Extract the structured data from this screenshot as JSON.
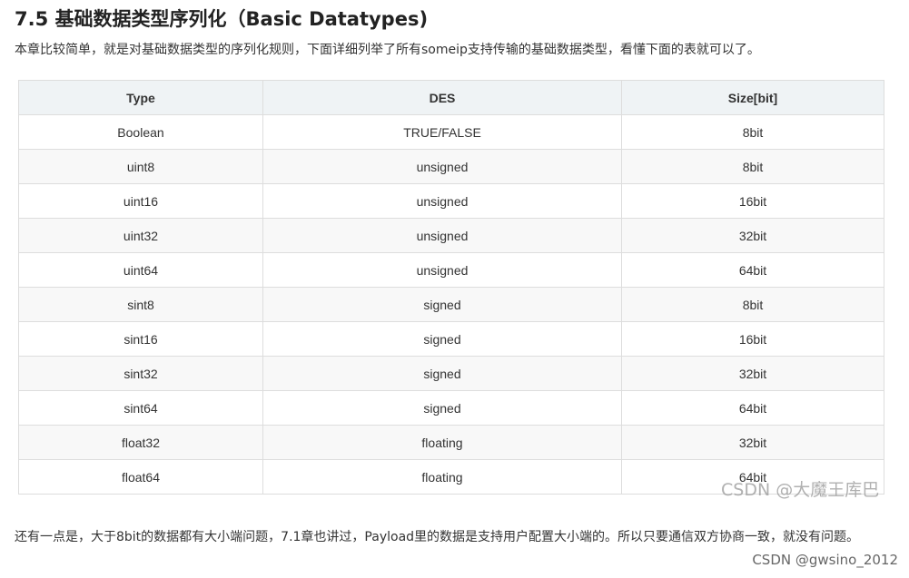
{
  "heading": "7.5 基础数据类型序列化（Basic Datatypes)",
  "intro": "本章比较简单，就是对基础数据类型的序列化规则，下面详细列举了所有someip支持传输的基础数据类型，看懂下面的表就可以了。",
  "table": {
    "headers": [
      "Type",
      "DES",
      "Size[bit]"
    ],
    "rows": [
      [
        "Boolean",
        "TRUE/FALSE",
        "8bit"
      ],
      [
        "uint8",
        "unsigned",
        "8bit"
      ],
      [
        "uint16",
        "unsigned",
        "16bit"
      ],
      [
        "uint32",
        "unsigned",
        "32bit"
      ],
      [
        "uint64",
        "unsigned",
        "64bit"
      ],
      [
        "sint8",
        "signed",
        "8bit"
      ],
      [
        "sint16",
        "signed",
        "16bit"
      ],
      [
        "sint32",
        "signed",
        "32bit"
      ],
      [
        "sint64",
        "signed",
        "64bit"
      ],
      [
        "float32",
        "floating",
        "32bit"
      ],
      [
        "float64",
        "floating",
        "64bit"
      ]
    ]
  },
  "watermark_table": "CSDN @大魔王库巴",
  "note": "还有一点是，大于8bit的数据都有大小端问题，7.1章也讲过，Payload里的数据是支持用户配置大小端的。所以只要通信双方协商一致，就没有问题。",
  "watermark_footer": "CSDN @gwsino_2012"
}
